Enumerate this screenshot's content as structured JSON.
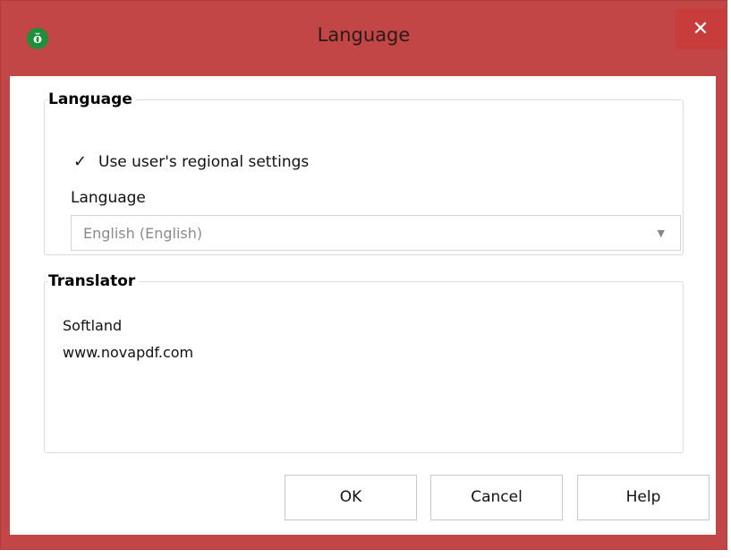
{
  "window": {
    "title": "Language",
    "app_icon_glyph": "ŏ",
    "close_glyph": "✕"
  },
  "language_group": {
    "legend": "Language",
    "checkbox": {
      "label": "Use user's regional settings",
      "checked": true,
      "glyph": "✓"
    },
    "field_label": "Language",
    "select": {
      "value": "English (English)",
      "arrow_glyph": "▼",
      "enabled": false
    }
  },
  "translator_group": {
    "legend": "Translator",
    "lines": [
      "Softland",
      "www.novapdf.com"
    ]
  },
  "buttons": {
    "ok": "OK",
    "cancel": "Cancel",
    "help": "Help"
  },
  "colors": {
    "frame": "#c34646",
    "close_hover": "#c83c3c",
    "app_icon": "#1f8f3a"
  }
}
